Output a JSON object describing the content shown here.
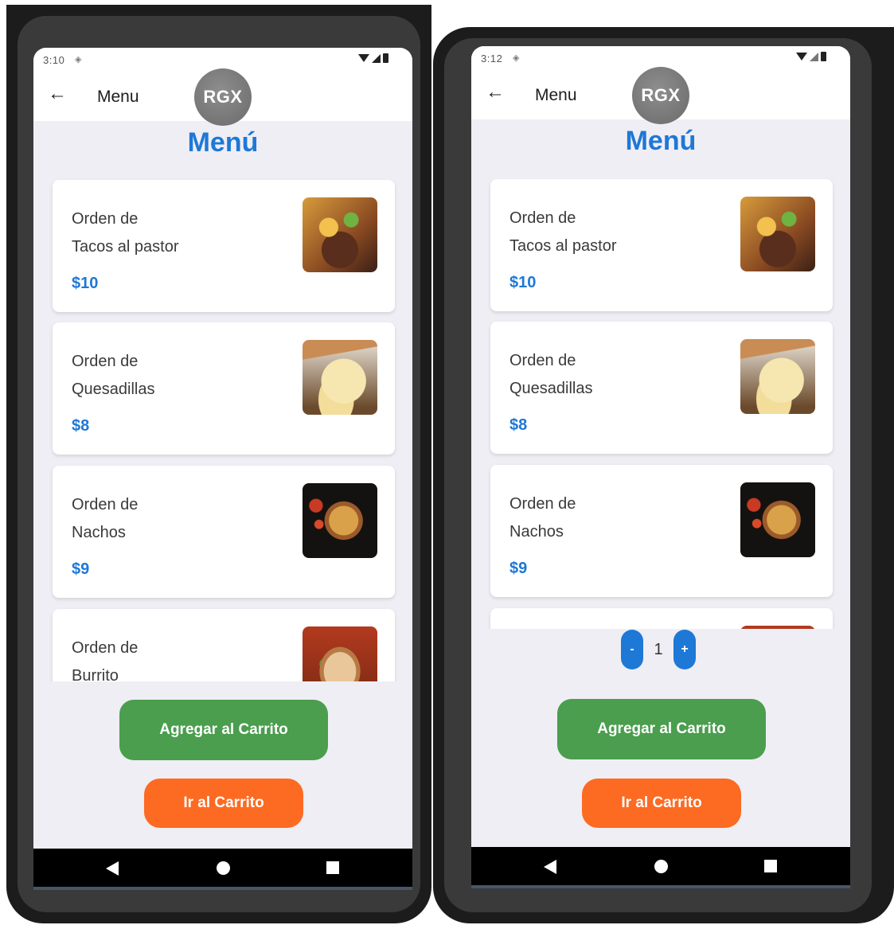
{
  "screens": [
    {
      "status_time": "3:10",
      "app_title": "Menu",
      "logo_text": "RGX",
      "heading": "Menú",
      "items": [
        {
          "line1": "Orden de",
          "line2": "Tacos al pastor",
          "price": "$10",
          "image": "tacos-image"
        },
        {
          "line1": "Orden de",
          "line2": "Quesadillas",
          "price": "$8",
          "image": "quesadillas-image"
        },
        {
          "line1": "Orden de",
          "line2": "Nachos",
          "price": "$9",
          "image": "nachos-image"
        },
        {
          "line1": "Orden de",
          "line2": "Burrito",
          "price": "",
          "image": "burrito-image"
        }
      ],
      "add_button": "Agregar al Carrito",
      "cart_button": "Ir al Carrito"
    },
    {
      "status_time": "3:12",
      "app_title": "Menu",
      "logo_text": "RGX",
      "heading": "Menú",
      "items": [
        {
          "line1": "Orden de",
          "line2": "Tacos al pastor",
          "price": "$10",
          "image": "tacos-image"
        },
        {
          "line1": "Orden de",
          "line2": "Quesadillas",
          "price": "$8",
          "image": "quesadillas-image"
        },
        {
          "line1": "Orden de",
          "line2": "Nachos",
          "price": "$9",
          "image": "nachos-image"
        }
      ],
      "stepper": {
        "minus": "-",
        "value": "1",
        "plus": "+"
      },
      "add_button": "Agregar al Carrito",
      "cart_button": "Ir al Carrito"
    }
  ],
  "colors": {
    "accent_blue": "#1e78d6",
    "add_green": "#4a9e4e",
    "cart_orange": "#fd6a22",
    "screen_bg": "#efeef4"
  }
}
